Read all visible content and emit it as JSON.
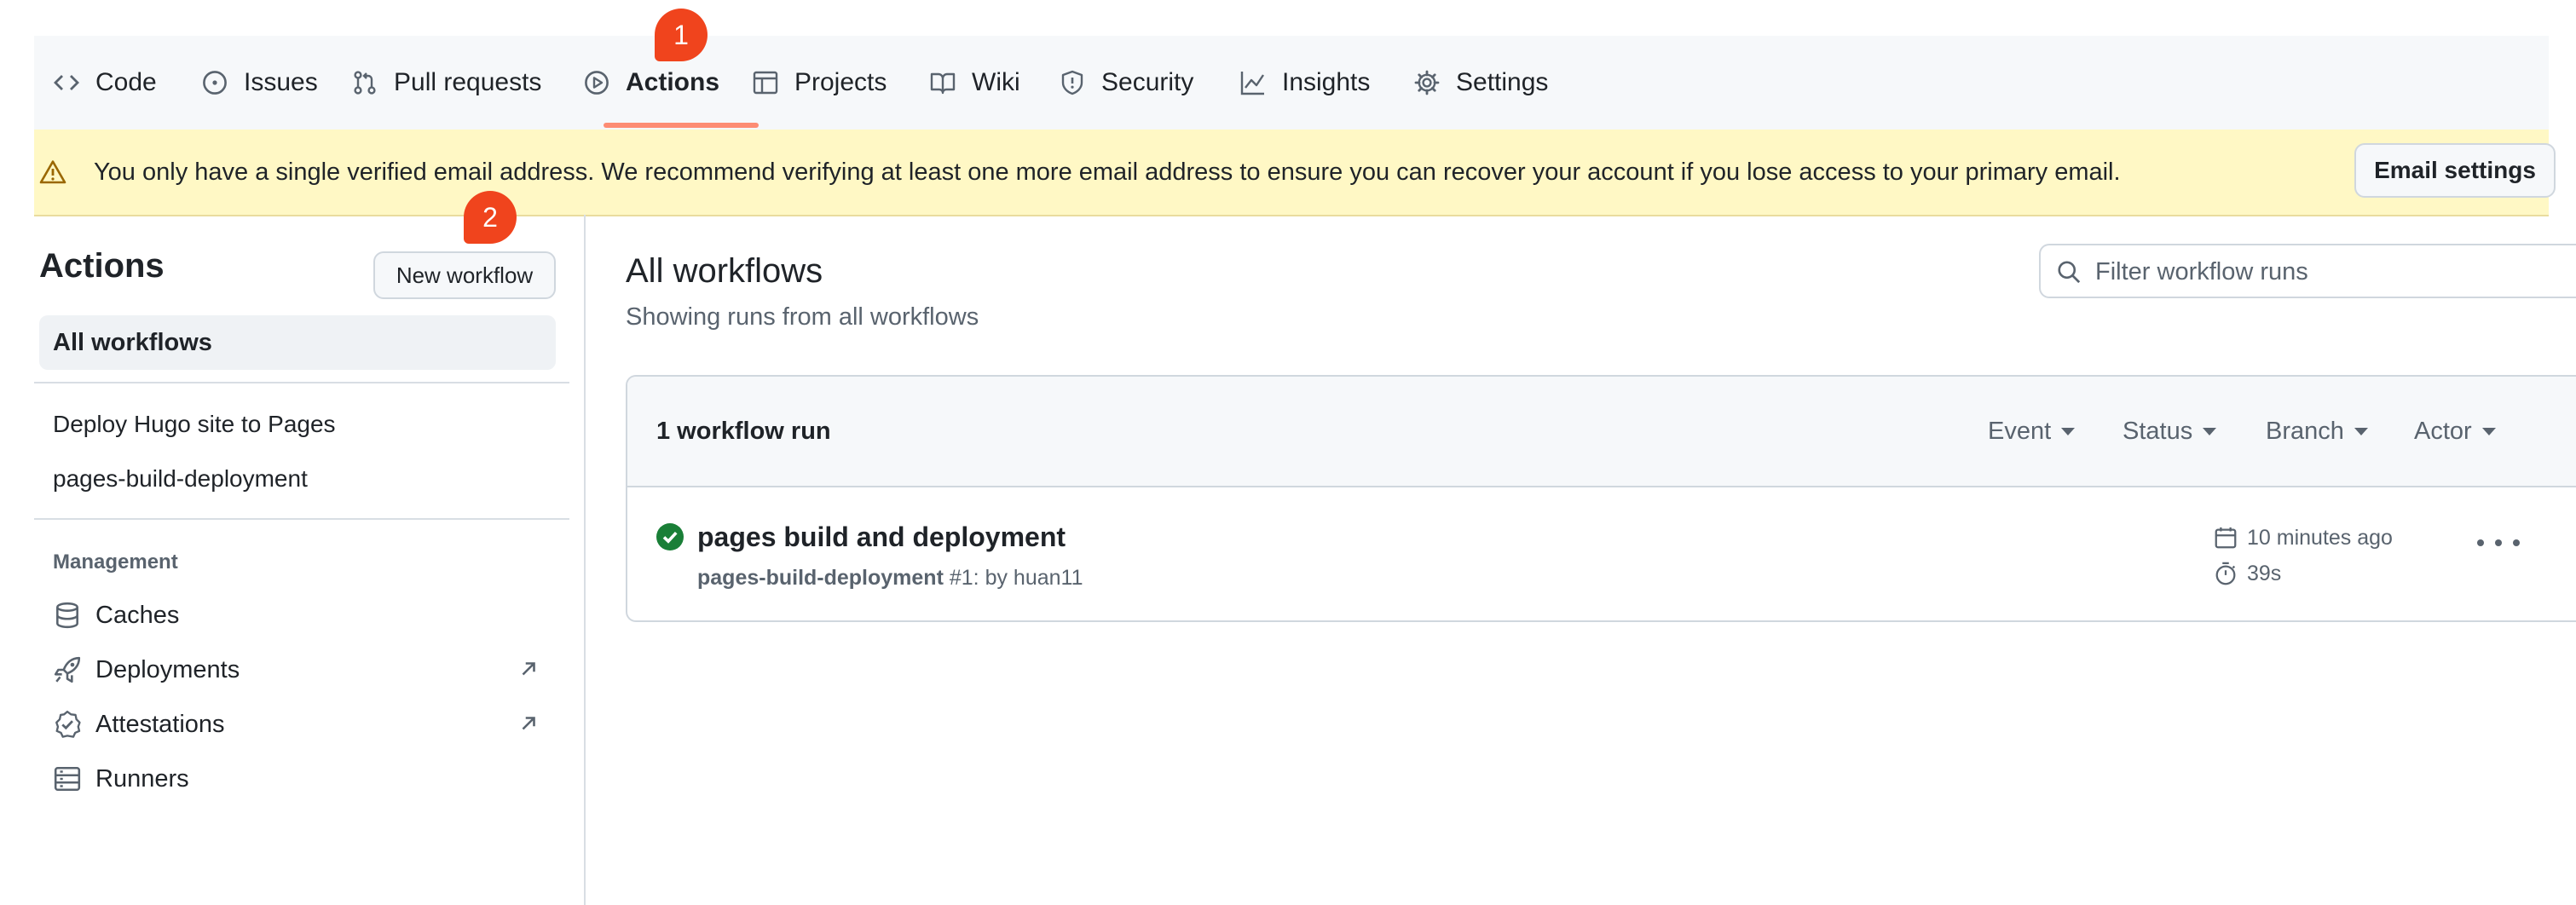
{
  "nav": {
    "tabs": [
      {
        "label": "Code",
        "icon": "code-icon"
      },
      {
        "label": "Issues",
        "icon": "issue-icon"
      },
      {
        "label": "Pull requests",
        "icon": "pull-request-icon"
      },
      {
        "label": "Actions",
        "icon": "play-icon",
        "active": true
      },
      {
        "label": "Projects",
        "icon": "table-icon"
      },
      {
        "label": "Wiki",
        "icon": "book-icon"
      },
      {
        "label": "Security",
        "icon": "shield-icon"
      },
      {
        "label": "Insights",
        "icon": "graph-icon"
      },
      {
        "label": "Settings",
        "icon": "gear-icon"
      }
    ]
  },
  "badges": {
    "first": "1",
    "second": "2"
  },
  "banner": {
    "message": "You only have a single verified email address. We recommend verifying at least one more email address to ensure you can recover your account if you lose access to your primary email.",
    "button": "Email settings"
  },
  "sidebar": {
    "title": "Actions",
    "new_workflow": "New workflow",
    "all_workflows": "All workflows",
    "workflows": [
      "Deploy Hugo site to Pages",
      "pages-build-deployment"
    ],
    "management_heading": "Management",
    "management": [
      {
        "label": "Caches",
        "icon": "database-icon"
      },
      {
        "label": "Deployments",
        "icon": "rocket-icon",
        "external": true
      },
      {
        "label": "Attestations",
        "icon": "verified-icon",
        "external": true
      },
      {
        "label": "Runners",
        "icon": "server-icon"
      }
    ]
  },
  "main": {
    "title": "All workflows",
    "subtitle": "Showing runs from all workflows",
    "filter_placeholder": "Filter workflow runs",
    "run_count": "1 workflow run",
    "filters": [
      "Event",
      "Status",
      "Branch",
      "Actor"
    ],
    "run": {
      "title": "pages build and deployment",
      "workflow": "pages-build-deployment",
      "number": "#1",
      "actor_text": ": by huan11",
      "when": "10 minutes ago",
      "duration": "39s",
      "status": "success"
    }
  },
  "colors": {
    "accent_underline": "#fd8c73",
    "badge": "#f0441d",
    "success": "#1a7f37",
    "banner_bg": "#fff8c5"
  }
}
